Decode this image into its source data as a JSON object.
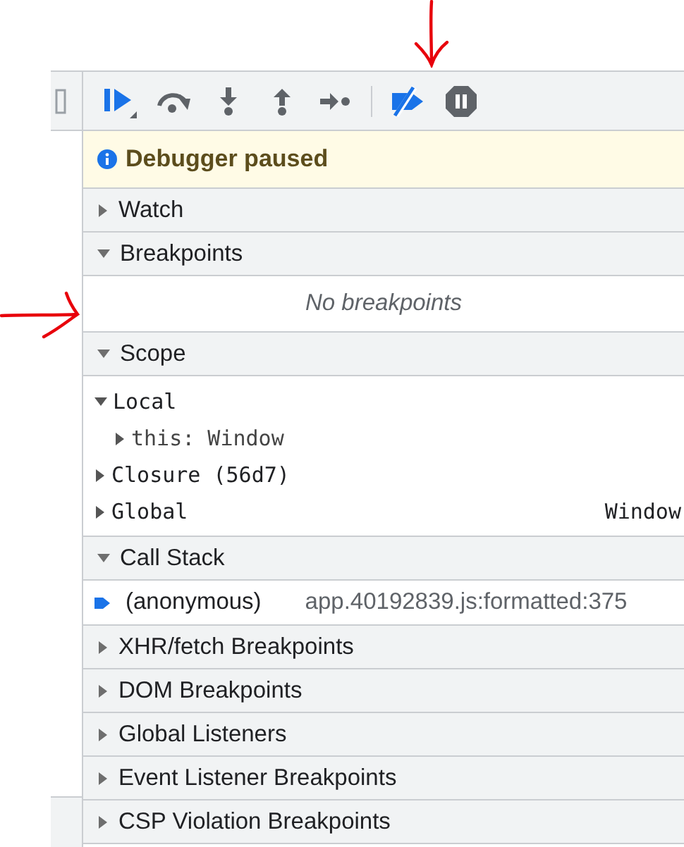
{
  "toolbar": {
    "buttons": [
      {
        "kind": "resume"
      },
      {
        "kind": "step-over"
      },
      {
        "kind": "step-into"
      },
      {
        "kind": "step-out"
      },
      {
        "kind": "step"
      },
      {
        "kind": "deactivate-breakpoints",
        "selected": true
      },
      {
        "kind": "pause-on-exceptions",
        "selected": false
      }
    ]
  },
  "paused_banner": {
    "text": "Debugger paused"
  },
  "sections": [
    {
      "title": "Watch",
      "expanded": false
    },
    {
      "title": "Breakpoints",
      "expanded": true,
      "empty_text": "No breakpoints"
    },
    {
      "title": "Scope",
      "expanded": true,
      "scopes": [
        {
          "name": "Local",
          "expanded": true,
          "children": [
            {
              "name": "this: Window",
              "expanded": false
            }
          ]
        },
        {
          "name": "Closure (56d7)",
          "expanded": false
        },
        {
          "name": "Global",
          "value": "Window",
          "expanded": false
        }
      ]
    },
    {
      "title": "Call Stack",
      "expanded": true,
      "frames": [
        {
          "function": "(anonymous)",
          "location": "app.40192839.js:formatted:375",
          "selected": true
        }
      ]
    },
    {
      "title": "XHR/fetch Breakpoints",
      "expanded": false
    },
    {
      "title": "DOM Breakpoints",
      "expanded": false
    },
    {
      "title": "Global Listeners",
      "expanded": false
    },
    {
      "title": "Event Listener Breakpoints",
      "expanded": false
    },
    {
      "title": "CSP Violation Breakpoints",
      "expanded": false
    }
  ],
  "annotations": [
    {
      "kind": "down-arrow"
    },
    {
      "kind": "right-arrow"
    }
  ]
}
